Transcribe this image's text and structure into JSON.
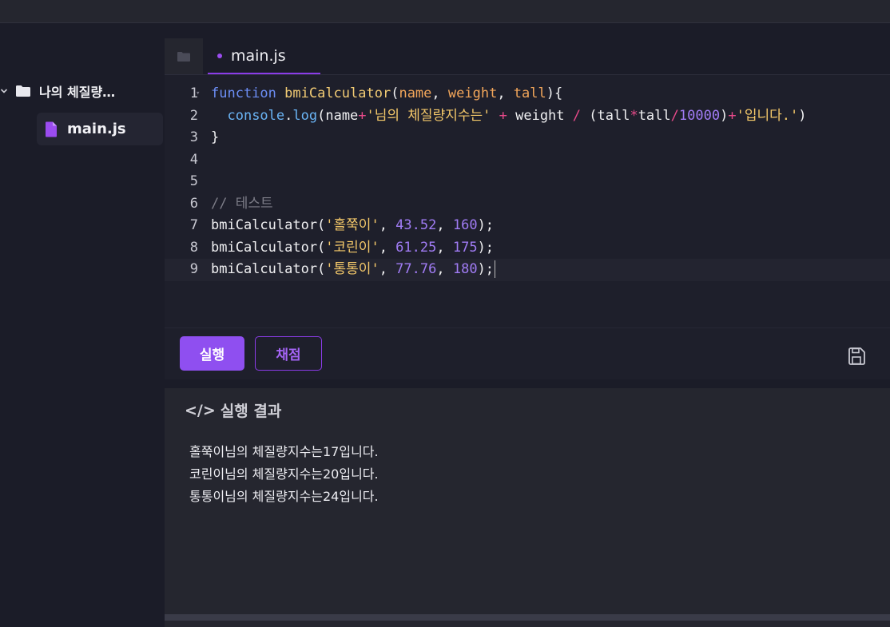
{
  "colors": {
    "accent": "#8f4ff0",
    "keyword": "#6c8ef5",
    "function_name": "#f2cb74",
    "param": "#f2a65a",
    "string": "#f5c96a",
    "number": "#a17cf5",
    "operator": "#e84a8a",
    "comment": "#7d7d88",
    "method": "#6ab4f5"
  },
  "sidebar": {
    "folder_label": "나의 체질량…",
    "folder_icon": "folder-icon",
    "chevron_icon": "chevron-down-icon",
    "file_label": "main.js",
    "file_icon": "file-icon"
  },
  "tabs": {
    "folder_icon": "folder-icon",
    "active_label": "main.js"
  },
  "code": {
    "lines": [
      {
        "n": "1",
        "tokens": [
          {
            "t": "function",
            "c": "keyword"
          },
          {
            "t": " ",
            "c": "plain"
          },
          {
            "t": "bmiCalculator",
            "c": "function_name"
          },
          {
            "t": "(",
            "c": "plain"
          },
          {
            "t": "name",
            "c": "param"
          },
          {
            "t": ", ",
            "c": "plain"
          },
          {
            "t": "weight",
            "c": "param"
          },
          {
            "t": ", ",
            "c": "plain"
          },
          {
            "t": "tall",
            "c": "param"
          },
          {
            "t": "){",
            "c": "plain"
          }
        ]
      },
      {
        "n": "2",
        "tokens": [
          {
            "t": "  ",
            "c": "plain"
          },
          {
            "t": "console",
            "c": "method"
          },
          {
            "t": ".",
            "c": "plain"
          },
          {
            "t": "log",
            "c": "method"
          },
          {
            "t": "(name",
            "c": "plain"
          },
          {
            "t": "+",
            "c": "operator"
          },
          {
            "t": "'님의 체질량지수는'",
            "c": "string"
          },
          {
            "t": " ",
            "c": "plain"
          },
          {
            "t": "+",
            "c": "operator"
          },
          {
            "t": " weight ",
            "c": "plain"
          },
          {
            "t": "/",
            "c": "operator"
          },
          {
            "t": " (tall",
            "c": "plain"
          },
          {
            "t": "*",
            "c": "operator"
          },
          {
            "t": "tall",
            "c": "plain"
          },
          {
            "t": "/",
            "c": "operator"
          },
          {
            "t": "10000",
            "c": "number"
          },
          {
            "t": ")",
            "c": "plain"
          },
          {
            "t": "+",
            "c": "operator"
          },
          {
            "t": "'입니다.'",
            "c": "string"
          },
          {
            "t": ")",
            "c": "plain"
          }
        ]
      },
      {
        "n": "3",
        "tokens": [
          {
            "t": "}",
            "c": "plain"
          }
        ]
      },
      {
        "n": "4",
        "tokens": []
      },
      {
        "n": "5",
        "tokens": []
      },
      {
        "n": "6",
        "tokens": [
          {
            "t": "// 테스트",
            "c": "comment"
          }
        ]
      },
      {
        "n": "7",
        "tokens": [
          {
            "t": "bmiCalculator(",
            "c": "plain"
          },
          {
            "t": "'홀쭉이'",
            "c": "string"
          },
          {
            "t": ", ",
            "c": "plain"
          },
          {
            "t": "43.52",
            "c": "number"
          },
          {
            "t": ", ",
            "c": "plain"
          },
          {
            "t": "160",
            "c": "number"
          },
          {
            "t": ");",
            "c": "plain"
          }
        ]
      },
      {
        "n": "8",
        "tokens": [
          {
            "t": "bmiCalculator(",
            "c": "plain"
          },
          {
            "t": "'코린이'",
            "c": "string"
          },
          {
            "t": ", ",
            "c": "plain"
          },
          {
            "t": "61.25",
            "c": "number"
          },
          {
            "t": ", ",
            "c": "plain"
          },
          {
            "t": "175",
            "c": "number"
          },
          {
            "t": ");",
            "c": "plain"
          }
        ]
      },
      {
        "n": "9",
        "tokens": [
          {
            "t": "bmiCalculator(",
            "c": "plain"
          },
          {
            "t": "'통통이'",
            "c": "string"
          },
          {
            "t": ", ",
            "c": "plain"
          },
          {
            "t": "77.76",
            "c": "number"
          },
          {
            "t": ", ",
            "c": "plain"
          },
          {
            "t": "180",
            "c": "number"
          },
          {
            "t": ");",
            "c": "plain"
          }
        ]
      }
    ],
    "current_line": "9"
  },
  "actions": {
    "run_label": "실행",
    "grade_label": "채점",
    "save_icon": "save-icon"
  },
  "result": {
    "icon": "</>",
    "title": "실행 결과",
    "lines": [
      "홀쭉이님의 체질량지수는17입니다.",
      "코린이님의 체질량지수는20입니다.",
      "통통이님의 체질량지수는24입니다."
    ]
  }
}
